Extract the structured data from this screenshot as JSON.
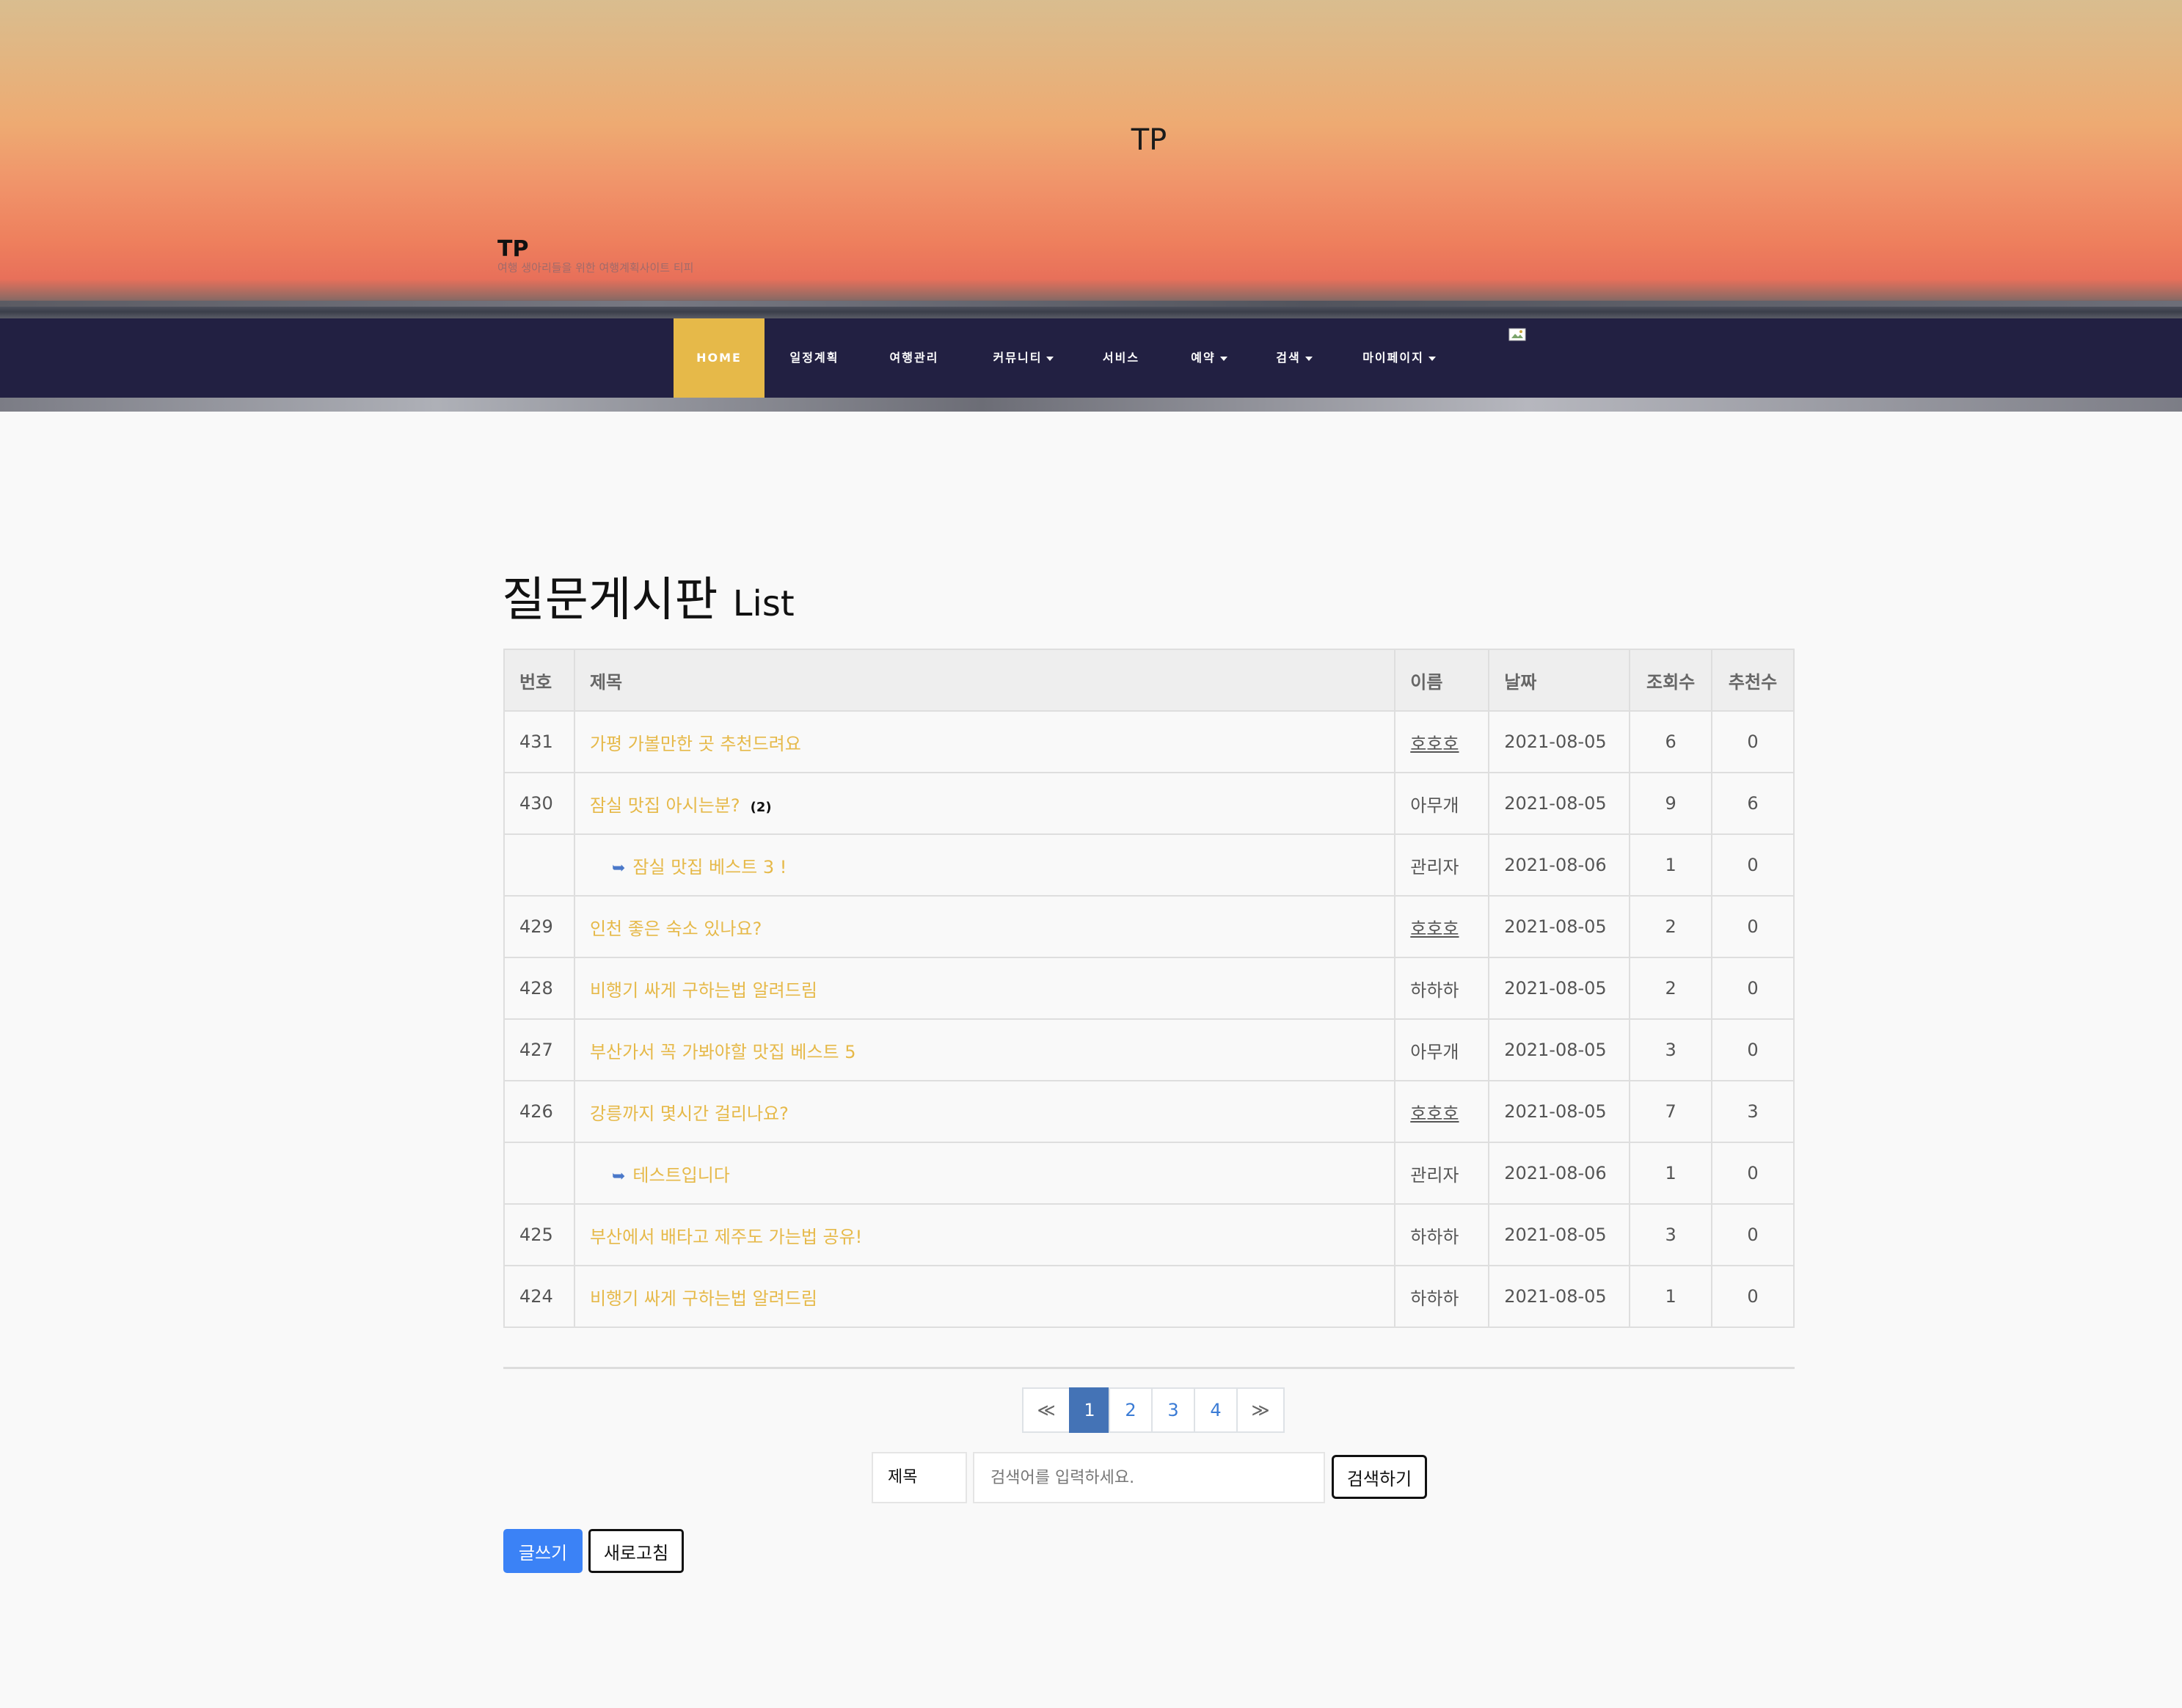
{
  "header": {
    "center_title": "TP",
    "brand_title": "TP",
    "brand_subtitle": "여행 생아리들을 위한 여행계획사이트 티피"
  },
  "nav": {
    "items": [
      {
        "label": "HOME",
        "active": true,
        "dropdown": false
      },
      {
        "label": "일정계획",
        "active": false,
        "dropdown": false
      },
      {
        "label": "여행관리",
        "active": false,
        "dropdown": false
      },
      {
        "label": "커뮤니티",
        "active": false,
        "dropdown": true
      },
      {
        "label": "서비스",
        "active": false,
        "dropdown": false
      },
      {
        "label": "예약",
        "active": false,
        "dropdown": true
      },
      {
        "label": "검색",
        "active": false,
        "dropdown": true
      },
      {
        "label": "마이페이지",
        "active": false,
        "dropdown": true
      }
    ]
  },
  "board": {
    "title": "질문게시판",
    "title_suffix": "List",
    "columns": [
      "번호",
      "제목",
      "이름",
      "날짜",
      "조회수",
      "추천수"
    ],
    "rows": [
      {
        "num": "431",
        "title": "가평 가볼만한 곳 추천드려요",
        "reply": false,
        "comments": "",
        "name": "호호호",
        "name_linked": true,
        "date": "2021-08-05",
        "views": "6",
        "likes": "0"
      },
      {
        "num": "430",
        "title": "잠실 맛집 아시는분?",
        "reply": false,
        "comments": "(2)",
        "name": "아무개",
        "name_linked": false,
        "date": "2021-08-05",
        "views": "9",
        "likes": "6"
      },
      {
        "num": "",
        "title": "잠실 맛집 베스트 3 !",
        "reply": true,
        "comments": "",
        "name": "관리자",
        "name_linked": false,
        "date": "2021-08-06",
        "views": "1",
        "likes": "0"
      },
      {
        "num": "429",
        "title": "인천 좋은 숙소 있나요?",
        "reply": false,
        "comments": "",
        "name": "호호호",
        "name_linked": true,
        "date": "2021-08-05",
        "views": "2",
        "likes": "0"
      },
      {
        "num": "428",
        "title": "비행기 싸게 구하는법 알려드림",
        "reply": false,
        "comments": "",
        "name": "하하하",
        "name_linked": false,
        "date": "2021-08-05",
        "views": "2",
        "likes": "0"
      },
      {
        "num": "427",
        "title": "부산가서 꼭 가봐야할 맛집 베스트 5",
        "reply": false,
        "comments": "",
        "name": "아무개",
        "name_linked": false,
        "date": "2021-08-05",
        "views": "3",
        "likes": "0"
      },
      {
        "num": "426",
        "title": "강릉까지 몇시간 걸리나요?",
        "reply": false,
        "comments": "",
        "name": "호호호",
        "name_linked": true,
        "date": "2021-08-05",
        "views": "7",
        "likes": "3"
      },
      {
        "num": "",
        "title": "테스트입니다",
        "reply": true,
        "comments": "",
        "name": "관리자",
        "name_linked": false,
        "date": "2021-08-06",
        "views": "1",
        "likes": "0"
      },
      {
        "num": "425",
        "title": "부산에서 배타고 제주도 가는법 공유!",
        "reply": false,
        "comments": "",
        "name": "하하하",
        "name_linked": false,
        "date": "2021-08-05",
        "views": "3",
        "likes": "0"
      },
      {
        "num": "424",
        "title": "비행기 싸게 구하는법 알려드림",
        "reply": false,
        "comments": "",
        "name": "하하하",
        "name_linked": false,
        "date": "2021-08-05",
        "views": "1",
        "likes": "0"
      }
    ],
    "reply_icon": "reply-arrow-icon",
    "accent_color": "#e6b949"
  },
  "pagination": {
    "prev": "≪",
    "pages": [
      "1",
      "2",
      "3",
      "4"
    ],
    "current": "1",
    "next": "≫"
  },
  "search": {
    "field": "제목",
    "placeholder": "검색어를 입력하세요.",
    "value": "",
    "button": "검색하기"
  },
  "actions": {
    "write": "글쓰기",
    "refresh": "새로고침"
  }
}
